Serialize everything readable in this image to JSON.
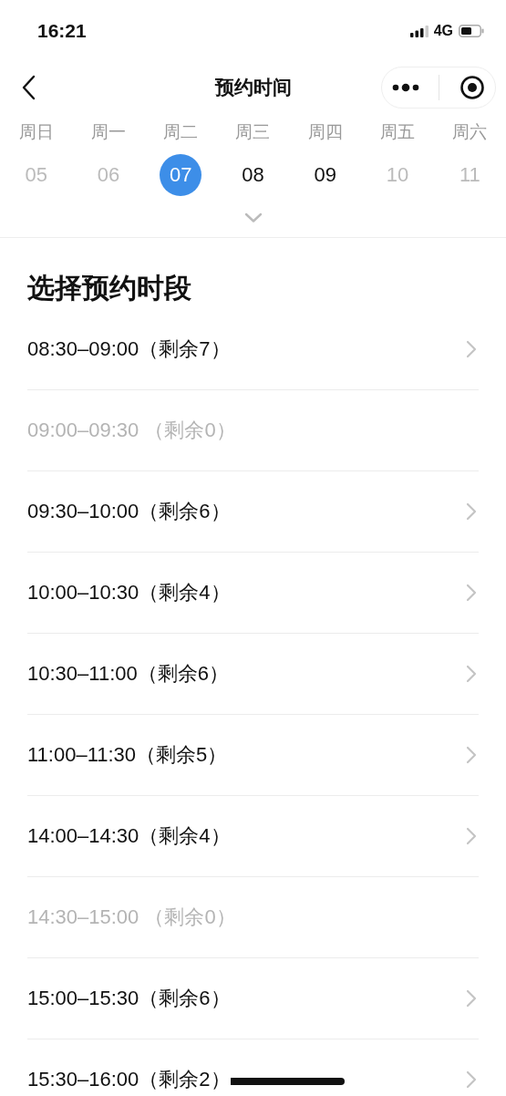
{
  "status_bar": {
    "time": "16:21",
    "network": "4G"
  },
  "nav": {
    "title": "预约时间"
  },
  "week": [
    {
      "weekday": "周日",
      "date": "05",
      "disabled": true,
      "selected": false
    },
    {
      "weekday": "周一",
      "date": "06",
      "disabled": true,
      "selected": false
    },
    {
      "weekday": "周二",
      "date": "07",
      "disabled": false,
      "selected": true
    },
    {
      "weekday": "周三",
      "date": "08",
      "disabled": false,
      "selected": false
    },
    {
      "weekday": "周四",
      "date": "09",
      "disabled": false,
      "selected": false
    },
    {
      "weekday": "周五",
      "date": "10",
      "disabled": true,
      "selected": false
    },
    {
      "weekday": "周六",
      "date": "11",
      "disabled": true,
      "selected": false
    }
  ],
  "section_title": "选择预约时段",
  "slots": [
    {
      "text": "08:30–09:00（剩余7）",
      "disabled": false
    },
    {
      "text": "09:00–09:30 （剩余0）",
      "disabled": true
    },
    {
      "text": "09:30–10:00（剩余6）",
      "disabled": false
    },
    {
      "text": "10:00–10:30（剩余4）",
      "disabled": false
    },
    {
      "text": "10:30–11:00（剩余6）",
      "disabled": false
    },
    {
      "text": "11:00–11:30（剩余5）",
      "disabled": false
    },
    {
      "text": "14:00–14:30（剩余4）",
      "disabled": false
    },
    {
      "text": "14:30–15:00 （剩余0）",
      "disabled": true
    },
    {
      "text": "15:00–15:30（剩余6）",
      "disabled": false
    },
    {
      "text": "15:30–16:00（剩余2）",
      "disabled": false
    }
  ]
}
